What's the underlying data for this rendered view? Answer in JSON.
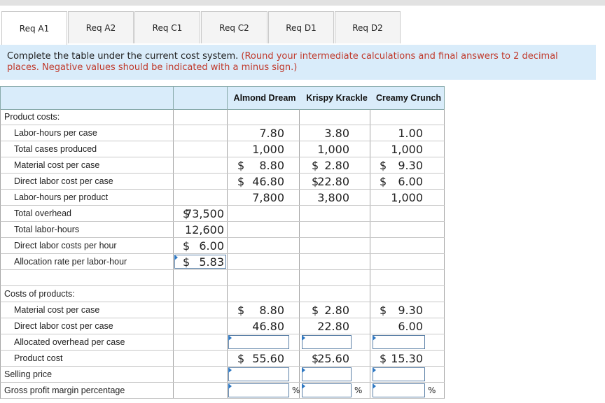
{
  "tabs": [
    "Req A1",
    "Req A2",
    "Req C1",
    "Req C2",
    "Req D1",
    "Req D2"
  ],
  "instructions": {
    "text": "Complete the table under the current cost system.",
    "note": "(Round your intermediate calculations and final answers to 2 decimal places. Negative values should be indicated with a minus sign.)"
  },
  "table": {
    "headers": [
      "Almond Dream",
      "Krispy Krackle",
      "Creamy Crunch"
    ],
    "rows": [
      {
        "label": "Product costs:",
        "indent": false,
        "total": "",
        "tdol": "",
        "vals": [
          "",
          "",
          ""
        ],
        "dols": [
          "",
          "",
          ""
        ]
      },
      {
        "label": "Labor-hours per case",
        "indent": true,
        "total": "",
        "tdol": "",
        "vals": [
          "7.80",
          "3.80",
          "1.00"
        ],
        "dols": [
          "",
          "",
          ""
        ]
      },
      {
        "label": "Total cases produced",
        "indent": true,
        "total": "",
        "tdol": "",
        "vals": [
          "1,000",
          "1,000",
          "1,000"
        ],
        "dols": [
          "",
          "",
          ""
        ]
      },
      {
        "label": "Material cost per case",
        "indent": true,
        "total": "",
        "tdol": "",
        "vals": [
          "8.80",
          "2.80",
          "9.30"
        ],
        "dols": [
          "$",
          "$",
          "$"
        ]
      },
      {
        "label": "Direct labor cost per case",
        "indent": true,
        "total": "",
        "tdol": "",
        "vals": [
          "46.80",
          "22.80",
          "6.00"
        ],
        "dols": [
          "$",
          "$",
          "$"
        ]
      },
      {
        "label": "Labor-hours per product",
        "indent": true,
        "total": "",
        "tdol": "",
        "vals": [
          "7,800",
          "3,800",
          "1,000"
        ],
        "dols": [
          "",
          "",
          ""
        ]
      },
      {
        "label": "Total overhead",
        "indent": true,
        "total": "73,500",
        "tdol": "$",
        "vals": [
          "",
          "",
          ""
        ],
        "dols": [
          "",
          "",
          ""
        ]
      },
      {
        "label": "Total labor-hours",
        "indent": true,
        "total": "12,600",
        "tdol": "",
        "vals": [
          "",
          "",
          ""
        ],
        "dols": [
          "",
          "",
          ""
        ]
      },
      {
        "label": "Direct labor costs per hour",
        "indent": true,
        "total": "6.00",
        "tdol": "$",
        "vals": [
          "",
          "",
          ""
        ],
        "dols": [
          "",
          "",
          ""
        ]
      },
      {
        "label": "Allocation rate per labor-hour",
        "indent": true,
        "total": "5.83",
        "tdol": "$",
        "vals": [
          "",
          "",
          ""
        ],
        "dols": [
          "",
          "",
          ""
        ],
        "totalInput": true
      },
      {
        "label": "",
        "indent": false,
        "total": "",
        "tdol": "",
        "vals": [
          "",
          "",
          ""
        ],
        "dols": [
          "",
          "",
          ""
        ]
      },
      {
        "label": "Costs of products:",
        "indent": false,
        "total": "",
        "tdol": "",
        "vals": [
          "",
          "",
          ""
        ],
        "dols": [
          "",
          "",
          ""
        ]
      },
      {
        "label": "Material cost per case",
        "indent": true,
        "total": "",
        "tdol": "",
        "vals": [
          "8.80",
          "2.80",
          "9.30"
        ],
        "dols": [
          "$",
          "$",
          "$"
        ]
      },
      {
        "label": "Direct labor cost per case",
        "indent": true,
        "total": "",
        "tdol": "",
        "vals": [
          "46.80",
          "22.80",
          "6.00"
        ],
        "dols": [
          "",
          "",
          ""
        ]
      },
      {
        "label": "Allocated overhead per case",
        "indent": true,
        "total": "",
        "tdol": "",
        "vals": [
          "",
          "",
          ""
        ],
        "dols": [
          "",
          "",
          ""
        ],
        "inputs": true
      },
      {
        "label": "Product cost",
        "indent": true,
        "total": "",
        "tdol": "",
        "vals": [
          "55.60",
          "25.60",
          "15.30"
        ],
        "dols": [
          "$",
          "$",
          "$"
        ]
      },
      {
        "label": "Selling price",
        "indent": false,
        "total": "",
        "tdol": "",
        "vals": [
          "",
          "",
          ""
        ],
        "dols": [
          "",
          "",
          ""
        ],
        "inputs": true
      },
      {
        "label": "Gross profit margin percentage",
        "indent": false,
        "total": "",
        "tdol": "",
        "vals": [
          "",
          "",
          ""
        ],
        "dols": [
          "",
          "",
          ""
        ],
        "inputs": true,
        "pct": "%"
      }
    ]
  }
}
